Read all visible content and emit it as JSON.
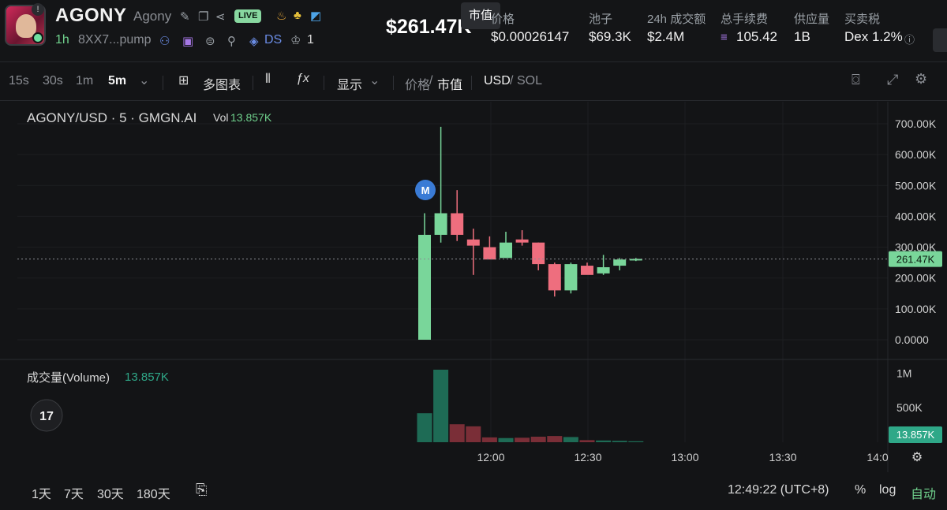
{
  "token": {
    "symbol": "AGONY",
    "name": "Agony",
    "live_label": "LIVE",
    "age": "1h",
    "address": "8XX7...pump",
    "ds_label": "DS",
    "holders_count": "1",
    "info_glyph": "!"
  },
  "market_cap_display": "$261.47K",
  "tooltip_text": "市值",
  "stats": [
    {
      "label": "价格",
      "value": "$0.00026147"
    },
    {
      "label": "池子",
      "value": "$69.3K"
    },
    {
      "label": "24h 成交额",
      "value": "$2.4M"
    },
    {
      "label": "总手续费",
      "value": "105.42"
    },
    {
      "label": "供应量",
      "value": "1B"
    },
    {
      "label": "买卖税",
      "value": "Dex 1.2%"
    }
  ],
  "toolbar": {
    "intervals": [
      "15s",
      "30s",
      "1m",
      "5m"
    ],
    "active_interval": "5m",
    "multi_chart": "多图表",
    "display": "显示",
    "price_label": "价格",
    "mcap_label": "市值",
    "usd_label": "USD",
    "sol_label": "SOL"
  },
  "chart_legend": {
    "pair": "AGONY/USD · 5 · GMGN.AI",
    "vol_label": "Vol",
    "vol_value": "13.857K",
    "volume_title": "成交量(Volume)",
    "volume_value": "13.857K",
    "marker": "M",
    "current_tag": "261.47K",
    "volume_tag": "13.857K"
  },
  "chart_data": {
    "type": "candlestick",
    "price_axis_labels": [
      "700.00K",
      "600.00K",
      "500.00K",
      "400.00K",
      "300.00K",
      "200.00K",
      "100.00K",
      "0.0000"
    ],
    "volume_axis_labels": [
      "1M",
      "500K"
    ],
    "time_axis_labels": [
      "12:00",
      "12:30",
      "13:00",
      "13:30",
      "14:0"
    ],
    "current_value": 261470,
    "ylim": [
      0,
      700000
    ],
    "candles": [
      {
        "o": 0,
        "h": 410000,
        "l": 0,
        "c": 340000,
        "vol": 420000
      },
      {
        "o": 340000,
        "h": 690000,
        "l": 315000,
        "c": 410000,
        "vol": 1050000
      },
      {
        "o": 410000,
        "h": 485000,
        "l": 320000,
        "c": 340000,
        "vol": 260000
      },
      {
        "o": 325000,
        "h": 360000,
        "l": 210000,
        "c": 305000,
        "vol": 230000
      },
      {
        "o": 300000,
        "h": 335000,
        "l": 265000,
        "c": 260000,
        "vol": 70000
      },
      {
        "o": 265000,
        "h": 350000,
        "l": 265000,
        "c": 315000,
        "vol": 60000
      },
      {
        "o": 325000,
        "h": 355000,
        "l": 305000,
        "c": 315000,
        "vol": 65000
      },
      {
        "o": 315000,
        "h": 315000,
        "l": 225000,
        "c": 245000,
        "vol": 80000
      },
      {
        "o": 245000,
        "h": 250000,
        "l": 140000,
        "c": 160000,
        "vol": 90000
      },
      {
        "o": 160000,
        "h": 250000,
        "l": 150000,
        "c": 245000,
        "vol": 75000
      },
      {
        "o": 240000,
        "h": 250000,
        "l": 215000,
        "c": 210000,
        "vol": 30000
      },
      {
        "o": 215000,
        "h": 275000,
        "l": 210000,
        "c": 235000,
        "vol": 25000
      },
      {
        "o": 240000,
        "h": 265000,
        "l": 225000,
        "c": 260000,
        "vol": 20000
      },
      {
        "o": 260000,
        "h": 265000,
        "l": 255000,
        "c": 262000,
        "vol": 14000
      }
    ]
  },
  "footer": {
    "ranges": [
      "1天",
      "7天",
      "30天",
      "180天"
    ],
    "time": "12:49:22 (UTC+8)",
    "percent": "%",
    "log": "log",
    "auto": "自动"
  },
  "colors": {
    "up": "#79d69a",
    "down": "#ee6e7e",
    "vol_up": "#1e6b55",
    "vol_down": "#7a2e37",
    "accent": "#6fd08c",
    "marker": "#3a7bd5"
  }
}
